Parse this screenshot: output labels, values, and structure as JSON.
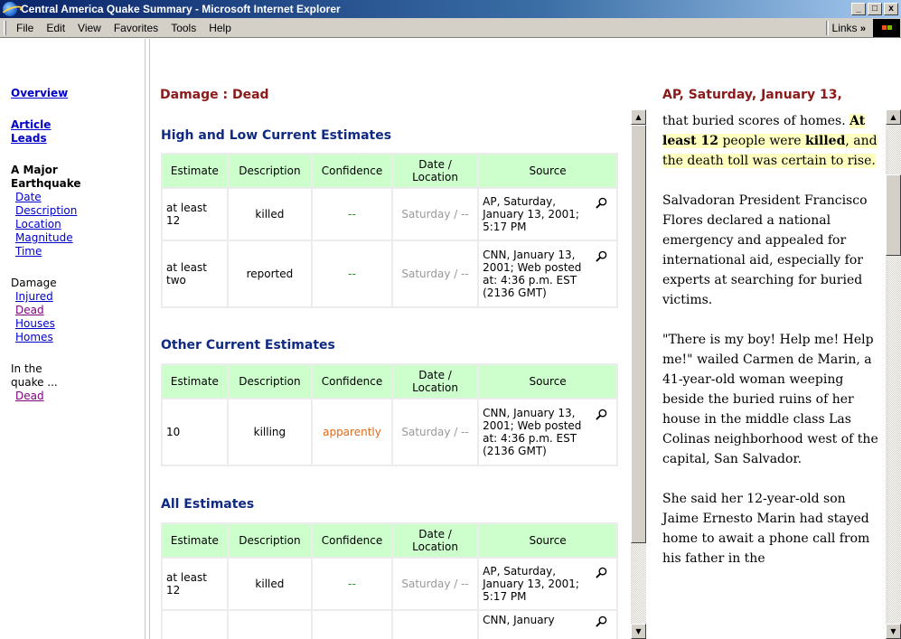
{
  "window": {
    "title": "Central America Quake Summary - Microsoft Internet Explorer",
    "min": "_",
    "max": "□",
    "close": "x"
  },
  "menu": {
    "items": [
      "File",
      "Edit",
      "View",
      "Favorites",
      "Tools",
      "Help"
    ],
    "links": "Links",
    "links_chevron": "»"
  },
  "nav": {
    "overview": "Overview",
    "article_leads": [
      "Article",
      "Leads"
    ],
    "major_header": [
      "A Major",
      "Earthquake"
    ],
    "major_items": [
      "Date",
      "Description",
      "Location",
      "Magnitude",
      "Time"
    ],
    "damage_header": "Damage",
    "damage_items": [
      "Injured",
      "Dead",
      "Houses",
      "Homes"
    ],
    "quake_header": [
      "In the",
      "quake ..."
    ],
    "quake_items": [
      "Dead"
    ]
  },
  "middle": {
    "page_title": "Damage : Dead",
    "columns": [
      "Estimate",
      "Description",
      "Confidence",
      "Date / Location",
      "Source"
    ],
    "sections": [
      {
        "title": "High and Low Current Estimates",
        "rows": [
          {
            "estimate": "at least 12",
            "description": "killed",
            "confidence": "--",
            "date": "Saturday / --",
            "source": "AP, Saturday, January 13, 2001; 5:17 PM"
          },
          {
            "estimate": "at least two",
            "description": "reported",
            "confidence": "--",
            "date": "Saturday / --",
            "source": "CNN, January 13, 2001; Web posted at: 4:36 p.m. EST (2136 GMT)"
          }
        ]
      },
      {
        "title": "Other Current Estimates",
        "rows": [
          {
            "estimate": "10",
            "description": "killing",
            "confidence": "apparently",
            "date": "Saturday / --",
            "source": "CNN, January 13, 2001; Web posted at: 4:36 p.m. EST (2136 GMT)"
          }
        ]
      },
      {
        "title": "All Estimates",
        "rows": [
          {
            "estimate": "at least 12",
            "description": "killed",
            "confidence": "--",
            "date": "Saturday / --",
            "source": "AP, Saturday, January 13, 2001; 5:17 PM"
          },
          {
            "estimate": "",
            "description": "",
            "confidence": "",
            "date": "",
            "source": "CNN, January"
          }
        ]
      }
    ]
  },
  "article": {
    "title": "AP, Saturday, January 13,",
    "p1_start": "that buried scores of homes.",
    "p1_bold1": "At least 12",
    "p1_mid": " people were",
    "p1_bold2": "killed",
    "p1_end": ", and the death toll was certain to rise.",
    "p2": "Salvadoran President Francisco Flores declared a national emergency and appealed for international aid, especially for experts at searching for buried victims.",
    "p3": "\"There is my boy! Help me! Help me!\" wailed Carmen de Marin, a 41-year-old woman weeping beside the buried ruins of her house in the middle class Las Colinas neighborhood west of the capital, San Salvador.",
    "p4": "She said her 12-year-old son Jaime Ernesto Marin had stayed home to await a phone call from his father in the"
  }
}
